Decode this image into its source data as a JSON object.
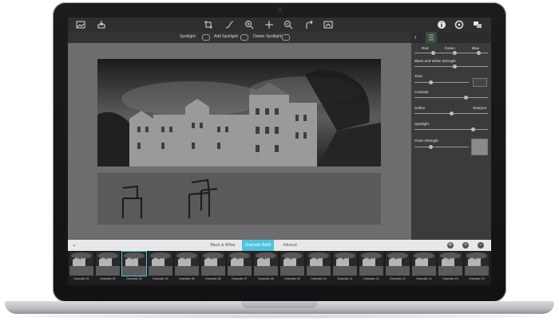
{
  "toolbar": {
    "left_icons": [
      "image-icon",
      "open-icon"
    ],
    "center_icons": [
      "crop-icon",
      "curve-icon",
      "zoom-in-icon",
      "move-icon",
      "zoom-out-icon",
      "redo-icon",
      "export-icon"
    ],
    "right_icons": [
      "info-icon",
      "settings-icon",
      "presets-icon"
    ]
  },
  "spotlight_bar": {
    "spotlight": "Spotlight:",
    "add_spotlight": "Add Spotlight:",
    "delete_spotlight": "Delete Spotlight:"
  },
  "panel": {
    "channels": [
      "Red",
      "Green",
      "Blue"
    ],
    "bw_strength": "Black and White Strength",
    "tone": "Tone",
    "contrast": "Contrast",
    "soften": "Soften",
    "sharpen": "Sharpen",
    "spotlight": "Spotlight",
    "grain": "Grain Strength",
    "levels": {
      "red": 0.25,
      "green": 0.55,
      "blue": 0.88,
      "bw_strength": 0.55,
      "tone": 0.3,
      "contrast": 0.7,
      "soften_sharpen": 0.5,
      "spotlight": 0.8,
      "grain": 0.3
    }
  },
  "tabs": [
    "Black & White",
    "Dramatic B&W",
    "Infrared"
  ],
  "active_tab": "Dramatic B&W",
  "filmstrip": {
    "labels": [
      "Dramatic 01",
      "Dramatic 02",
      "Dramatic 03",
      "Dramatic 04",
      "Dramatic 05",
      "Dramatic 06",
      "Dramatic 07",
      "Dramatic 08",
      "Dramatic 09",
      "Dramatic 10",
      "Dramatic 11",
      "Dramatic 12",
      "Dramatic 13",
      "Dramatic 14",
      "Dramatic 15",
      "Dramatic 16"
    ]
  },
  "colors": {
    "accent": "#4fc3dc",
    "toolbar": "#2f2f31",
    "panel": "#3b3b3d"
  }
}
